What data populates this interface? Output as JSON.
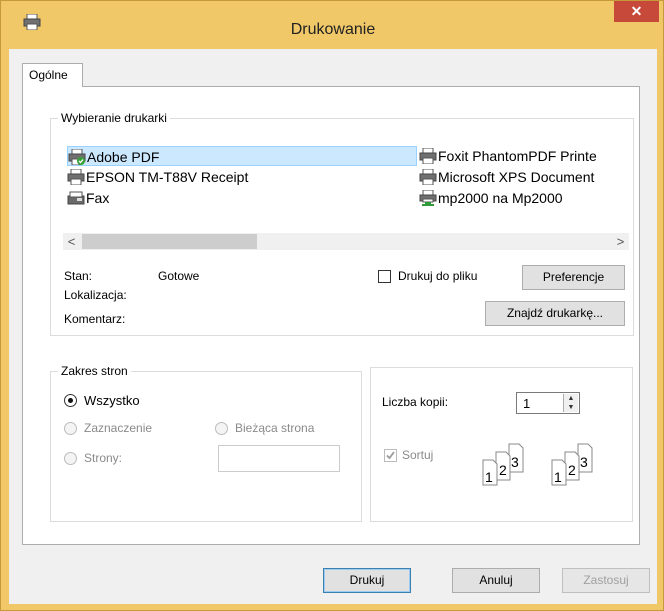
{
  "window": {
    "title": "Drukowanie",
    "close_glyph": "✕"
  },
  "tabs": [
    {
      "label": "Ogólne",
      "selected": true
    }
  ],
  "printer_select": {
    "legend": "Wybieranie drukarki",
    "printers": [
      {
        "name": "Adobe PDF",
        "selected": true,
        "default": true,
        "icon": "printer-default-icon"
      },
      {
        "name": "EPSON TM-T88V Receipt",
        "icon": "printer-icon"
      },
      {
        "name": "Fax",
        "icon": "fax-icon"
      },
      {
        "name": "Foxit PhantomPDF Printe",
        "icon": "printer-icon"
      },
      {
        "name": "Microsoft XPS Document",
        "icon": "printer-icon"
      },
      {
        "name": "mp2000 na Mp2000",
        "icon": "network-printer-icon"
      }
    ],
    "scroll_left": "<",
    "scroll_right": ">",
    "status_label": "Stan:",
    "status_value": "Gotowe",
    "location_label": "Lokalizacja:",
    "comment_label": "Komentarz:",
    "print_to_file_label": "Drukuj do pliku",
    "print_to_file_checked": false,
    "preferences_button": "Preferencje",
    "find_printer_button": "Znajdź drukarkę..."
  },
  "page_range": {
    "legend": "Zakres stron",
    "all_label": "Wszystko",
    "selection_label": "Zaznaczenie",
    "current_page_label": "Bieżąca strona",
    "pages_label": "Strony:",
    "selected_option": "all",
    "pages_value": ""
  },
  "copies": {
    "count_label": "Liczba kopii:",
    "count_value": "1",
    "collate_label": "Sortuj",
    "collate_checked": true,
    "collate_icon_digits": [
      "1",
      "2",
      "3"
    ]
  },
  "footer": {
    "print_button": "Drukuj",
    "cancel_button": "Anuluj",
    "apply_button": "Zastosuj"
  },
  "colors": {
    "title_bar": "#f0c868",
    "close_button": "#c7493a",
    "selection_highlight": "#cce8ff"
  }
}
